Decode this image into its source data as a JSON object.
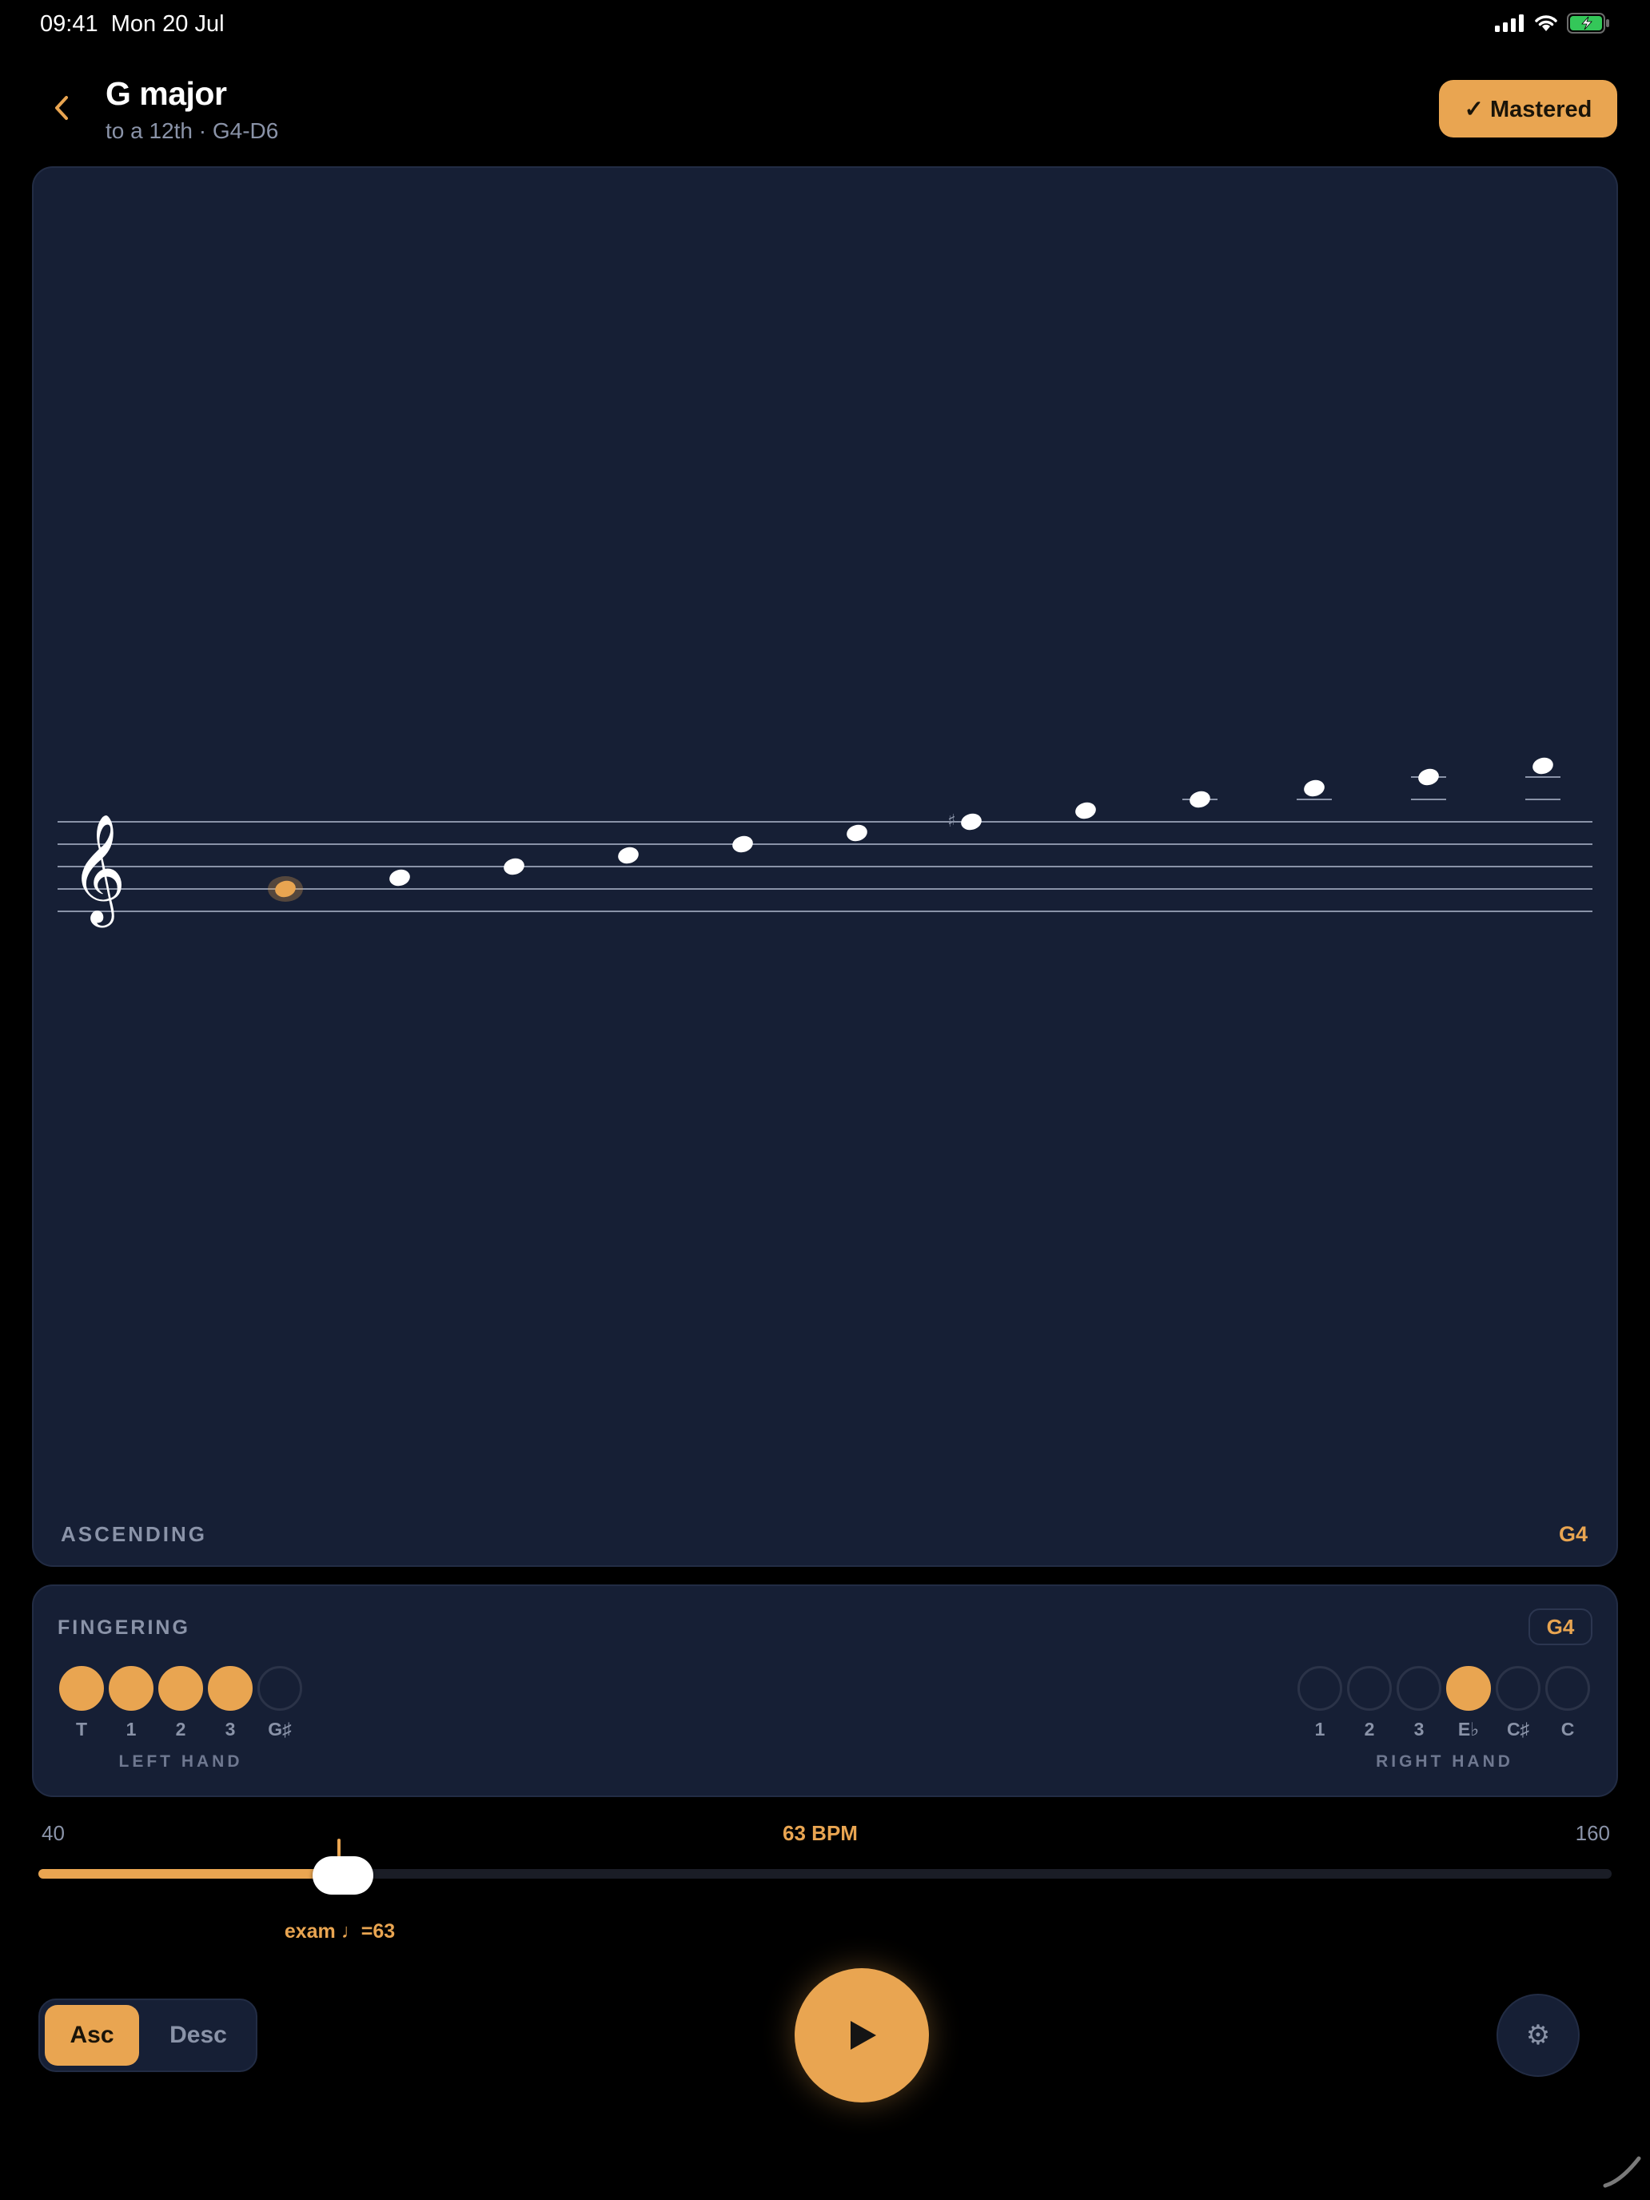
{
  "status_bar": {
    "time": "09:41",
    "date": "Mon 20 Jul",
    "icons": [
      "signal-icon",
      "wifi-icon",
      "battery-charging-icon"
    ]
  },
  "header": {
    "title": "G major",
    "subtitle": "to a 12th · G4-D6",
    "mastered_label": "✓ Mastered",
    "back_icon": "chevron-left-icon"
  },
  "staff": {
    "clef": "𝄞",
    "direction_label": "ASCENDING",
    "current_note": "G4",
    "accidental": "♯",
    "notes": [
      "G4",
      "A4",
      "B4",
      "C5",
      "D5",
      "E5",
      "F#5",
      "G5",
      "A5",
      "B5",
      "C6",
      "D6"
    ],
    "active_index": 0
  },
  "fingering": {
    "title": "FINGERING",
    "current_note": "G4",
    "left_hand": {
      "label": "LEFT HAND",
      "keys": [
        {
          "label": "T",
          "pressed": true
        },
        {
          "label": "1",
          "pressed": true
        },
        {
          "label": "2",
          "pressed": true
        },
        {
          "label": "3",
          "pressed": true
        },
        {
          "label": "G♯",
          "pressed": false
        }
      ]
    },
    "right_hand": {
      "label": "RIGHT HAND",
      "keys": [
        {
          "label": "1",
          "pressed": false
        },
        {
          "label": "2",
          "pressed": false
        },
        {
          "label": "3",
          "pressed": false
        },
        {
          "label": "E♭",
          "pressed": true
        },
        {
          "label": "C♯",
          "pressed": false
        },
        {
          "label": "C",
          "pressed": false
        }
      ]
    }
  },
  "tempo": {
    "min_label": "40",
    "max_label": "160",
    "current_label": "63 BPM",
    "min": 40,
    "max": 160,
    "value": 63,
    "exam_value": 63,
    "exam_label": "exam ♩=63"
  },
  "controls": {
    "asc_label": "Asc",
    "desc_label": "Desc",
    "selected": "Asc",
    "play_icon": "play-icon",
    "settings_icon": "gear-icon",
    "settings_glyph": "⚙"
  },
  "colors": {
    "accent": "#e9a551",
    "card": "#161f35",
    "muted": "#8a93a8"
  }
}
